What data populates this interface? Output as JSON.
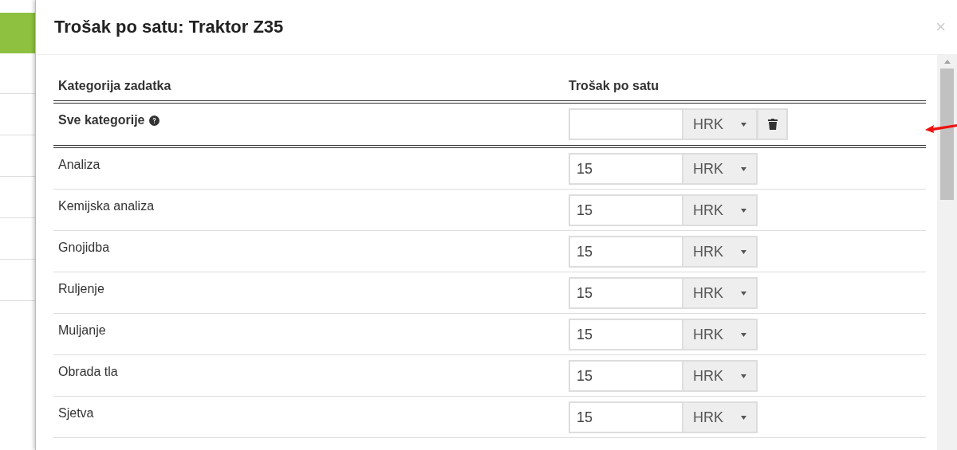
{
  "dialog": {
    "title": "Trošak po satu: Traktor Z35",
    "close": "×"
  },
  "table": {
    "columns": [
      "Kategorija zadatka",
      "Trošak po satu"
    ],
    "rows": [
      {
        "kind": "all",
        "category": "Sve kategorije",
        "currency": "HRK"
      },
      {
        "kind": "category",
        "category": "Analiza",
        "value": "15",
        "currency": "HRK"
      },
      {
        "kind": "category",
        "category": "Kemijska analiza",
        "value": "15",
        "currency": "HRK"
      },
      {
        "kind": "category",
        "category": "Gnojidba",
        "value": "15",
        "currency": "HRK"
      },
      {
        "kind": "category",
        "category": "Ruljenje",
        "value": "15",
        "currency": "HRK"
      },
      {
        "kind": "category",
        "category": "Muljanje",
        "value": "15",
        "currency": "HRK"
      },
      {
        "kind": "category",
        "category": "Obrada tla",
        "value": "15",
        "currency": "HRK"
      },
      {
        "kind": "category",
        "category": "Sjetva",
        "value": "15",
        "currency": "HRK"
      }
    ]
  }
}
